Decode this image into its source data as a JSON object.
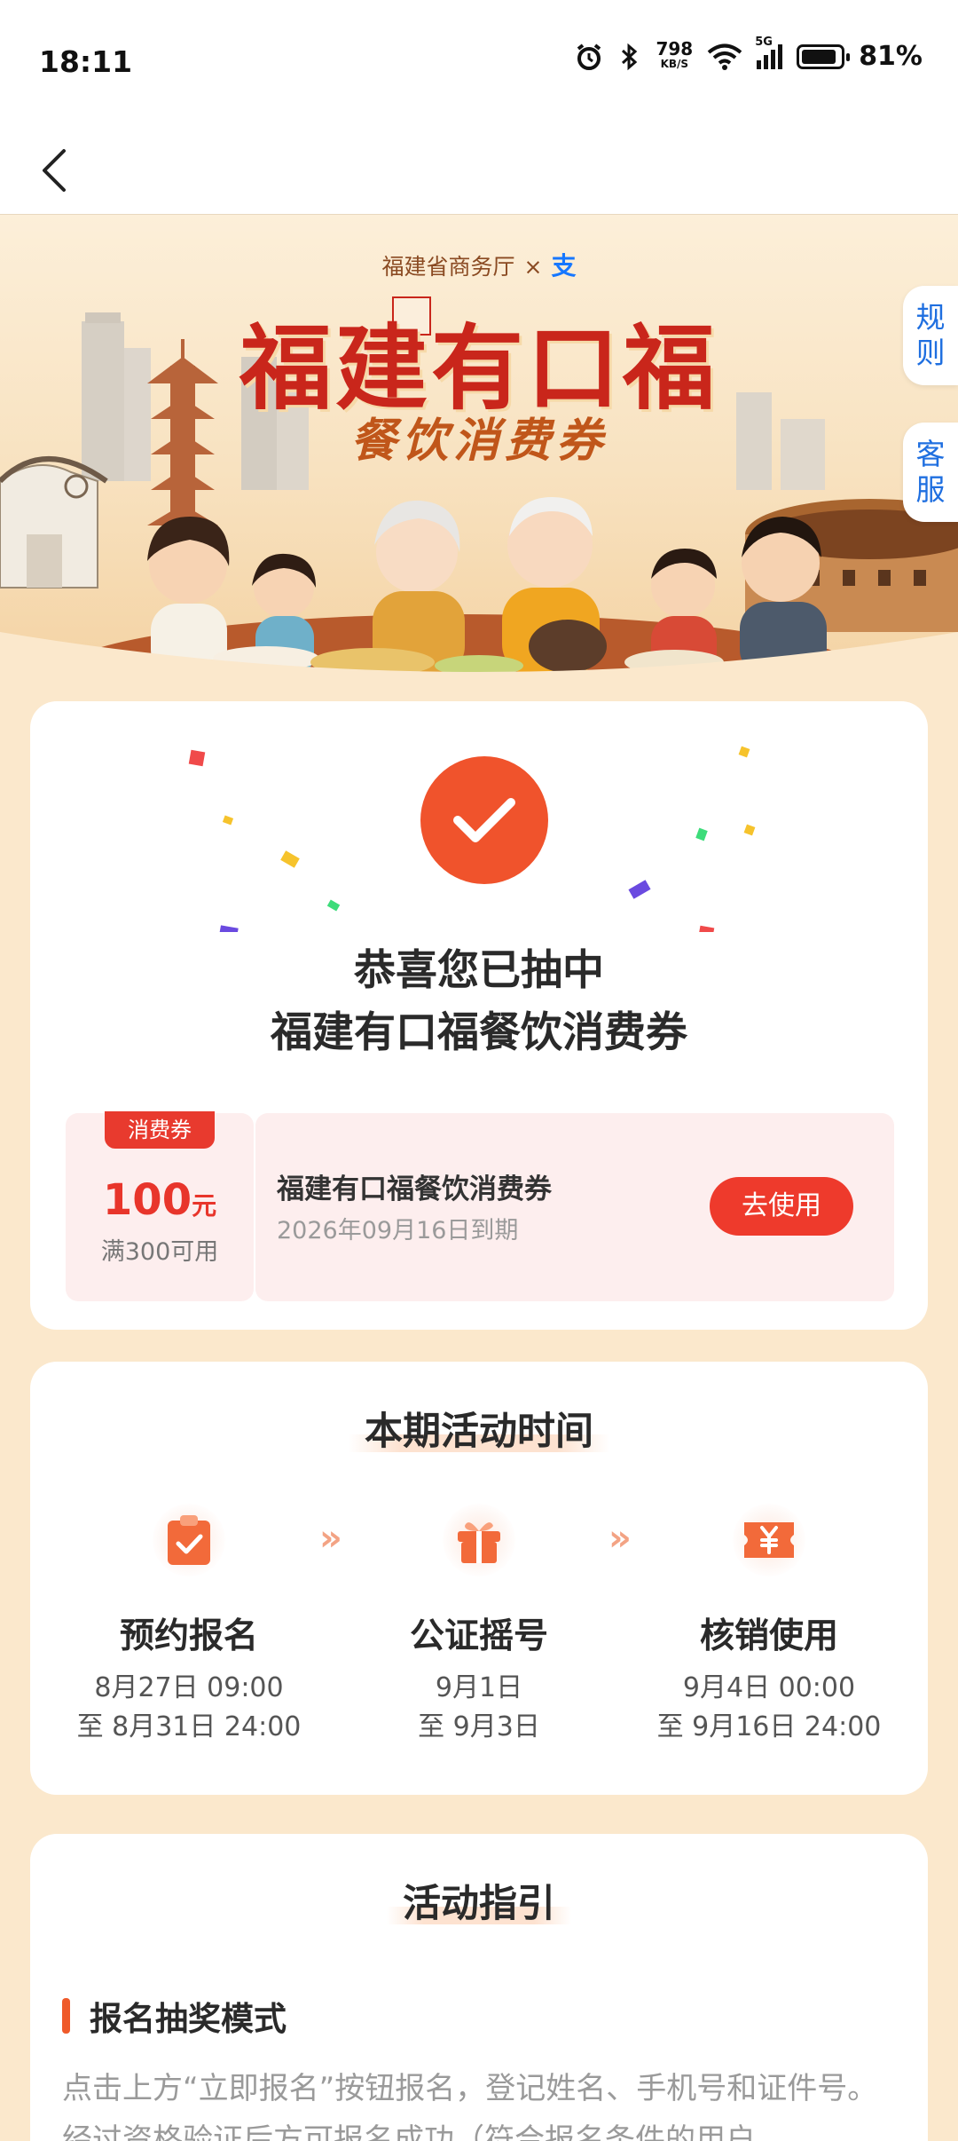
{
  "status_bar": {
    "time": "18:11",
    "net_speed_value": "798",
    "net_speed_unit": "KB/S",
    "network": "5G",
    "battery": "81%"
  },
  "nav": {
    "back_icon": "chevron-left-icon"
  },
  "banner": {
    "partner": "福建省商务厅",
    "times": "×",
    "alipay_glyph": "支",
    "title": "福建有口福",
    "subtitle": "餐饮消费券"
  },
  "side_tabs": {
    "rules": "规则",
    "service": "客服"
  },
  "result": {
    "line1": "恭喜您已抽中",
    "line2": "福建有口福餐饮消费券",
    "coupon": {
      "tag": "消费券",
      "amount": "100",
      "unit": "元",
      "condition": "满300可用",
      "name": "福建有口福餐饮消费券",
      "expiry": "2026年09月16日到期",
      "button": "去使用"
    }
  },
  "schedule": {
    "title": "本期活动时间",
    "steps": [
      {
        "icon": "clipboard-check-icon",
        "name": "预约报名",
        "date1": "8月27日 09:00",
        "date2": "至 8月31日 24:00"
      },
      {
        "icon": "gift-icon",
        "name": "公证摇号",
        "date1": "9月1日",
        "date2": "至 9月3日"
      },
      {
        "icon": "yuan-ticket-icon",
        "name": "核销使用",
        "date1": "9月4日 00:00",
        "date2": "至 9月16日 24:00"
      }
    ],
    "arrow": "»"
  },
  "guide": {
    "title": "活动指引",
    "heading": "报名抽奖模式",
    "text": "点击上方“立即报名”按钮报名，登记姓名、手机号和证件号。经过资格验证后方可报名成功（符合报名条件的用户"
  },
  "colors": {
    "accent": "#f0532c",
    "title_red": "#c9261b",
    "background": "#fbe8cc",
    "link_blue": "#1f6fe0"
  }
}
